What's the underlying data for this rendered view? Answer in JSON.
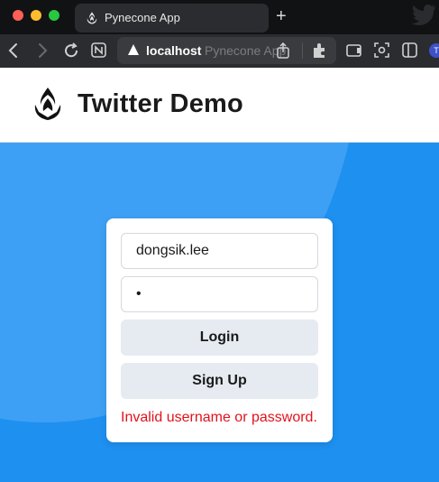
{
  "browser": {
    "tab_title": "Pynecone App",
    "new_tab_label": "+",
    "address_host": "localhost",
    "address_page_title": "Pynecone App",
    "profile_initial": "T"
  },
  "header": {
    "brand_title": "Twitter Demo"
  },
  "login": {
    "username_value": "dongsik.lee",
    "password_value": "•",
    "login_label": "Login",
    "signup_label": "Sign Up",
    "error_message": "Invalid username or password."
  },
  "colors": {
    "page_background": "#1e90f0",
    "error_text": "#e3121b",
    "button_background": "#e6ebf1"
  },
  "icons": {
    "tab_favicon": "pynecone-logo-icon",
    "brand": "pynecone-logo-icon",
    "twitter": "twitter-bird-icon"
  }
}
